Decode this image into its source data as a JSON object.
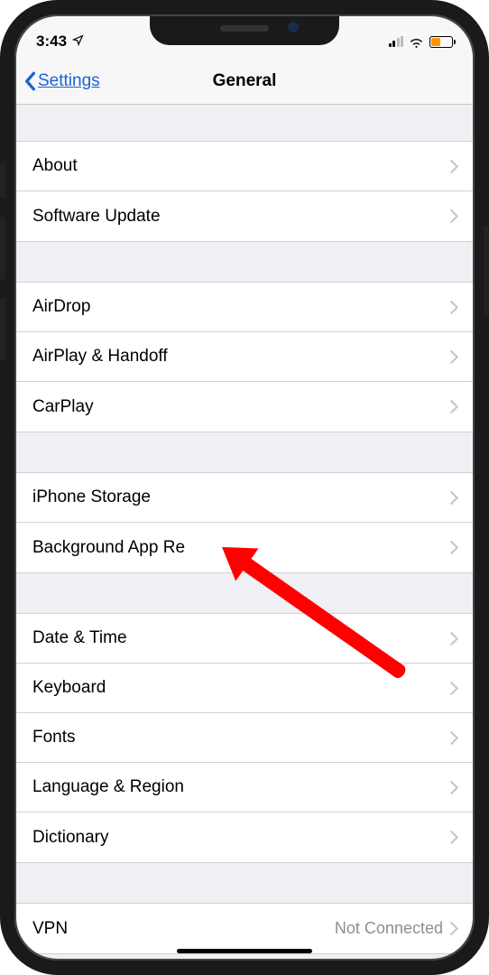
{
  "status_bar": {
    "time": "3:43",
    "battery_color": "#ff9500"
  },
  "nav": {
    "back_label": "Settings",
    "title": "General"
  },
  "groups": [
    {
      "items": [
        {
          "id": "about",
          "label": "About"
        },
        {
          "id": "software-update",
          "label": "Software Update"
        }
      ]
    },
    {
      "items": [
        {
          "id": "airdrop",
          "label": "AirDrop"
        },
        {
          "id": "airplay-handoff",
          "label": "AirPlay & Handoff"
        },
        {
          "id": "carplay",
          "label": "CarPlay"
        }
      ]
    },
    {
      "items": [
        {
          "id": "iphone-storage",
          "label": "iPhone Storage"
        },
        {
          "id": "background-app-refresh",
          "label": "Background App Re"
        }
      ]
    },
    {
      "items": [
        {
          "id": "date-time",
          "label": "Date & Time"
        },
        {
          "id": "keyboard",
          "label": "Keyboard"
        },
        {
          "id": "fonts",
          "label": "Fonts"
        },
        {
          "id": "language-region",
          "label": "Language & Region"
        },
        {
          "id": "dictionary",
          "label": "Dictionary"
        }
      ]
    },
    {
      "items": [
        {
          "id": "vpn",
          "label": "VPN",
          "detail": "Not Connected"
        }
      ]
    }
  ],
  "annotation": {
    "target": "iphone-storage",
    "color": "#ff0000"
  }
}
